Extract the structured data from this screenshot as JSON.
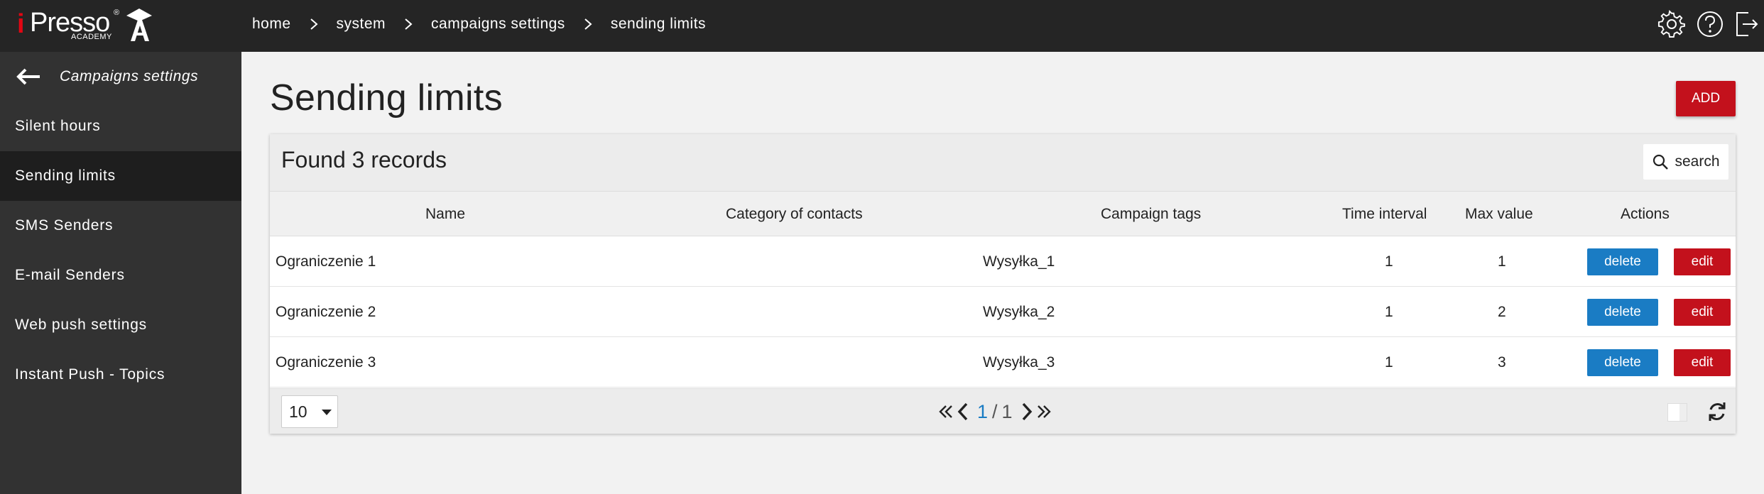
{
  "app": {
    "logo_i": "i",
    "logo_name": "Presso",
    "logo_reg": "®",
    "logo_sub": "ACADEMY",
    "accent": "#c3111c",
    "primary": "#1a7cc4"
  },
  "breadcrumb": [
    "home",
    "system",
    "campaigns settings",
    "sending limits"
  ],
  "top_icons": [
    "gear-icon",
    "help-icon",
    "logout-icon"
  ],
  "sidebar": {
    "header": "Campaigns settings",
    "items": [
      {
        "label": "Silent hours",
        "active": false
      },
      {
        "label": "Sending limits",
        "active": true
      },
      {
        "label": "SMS Senders",
        "active": false
      },
      {
        "label": "E-mail Senders",
        "active": false
      },
      {
        "label": "Web push settings",
        "active": false
      },
      {
        "label": "Instant Push - Topics",
        "active": false
      }
    ]
  },
  "main": {
    "title": "Sending limits",
    "add_label": "ADD",
    "found": "Found 3 records",
    "search_label": "search"
  },
  "table": {
    "columns": [
      "Name",
      "Category of contacts",
      "Campaign tags",
      "Time interval",
      "Max value",
      "Actions"
    ],
    "rows": [
      {
        "name": "Ograniczenie 1",
        "category": "",
        "tags": "Wysyłka_1",
        "interval": "1",
        "max": "1"
      },
      {
        "name": "Ograniczenie 2",
        "category": "",
        "tags": "Wysyłka_2",
        "interval": "1",
        "max": "2"
      },
      {
        "name": "Ograniczenie 3",
        "category": "",
        "tags": "Wysyłka_3",
        "interval": "1",
        "max": "3"
      }
    ],
    "delete_label": "delete",
    "edit_label": "edit"
  },
  "footer": {
    "per_page": "10",
    "current_page": "1",
    "separator": "/",
    "total_pages": "1"
  }
}
